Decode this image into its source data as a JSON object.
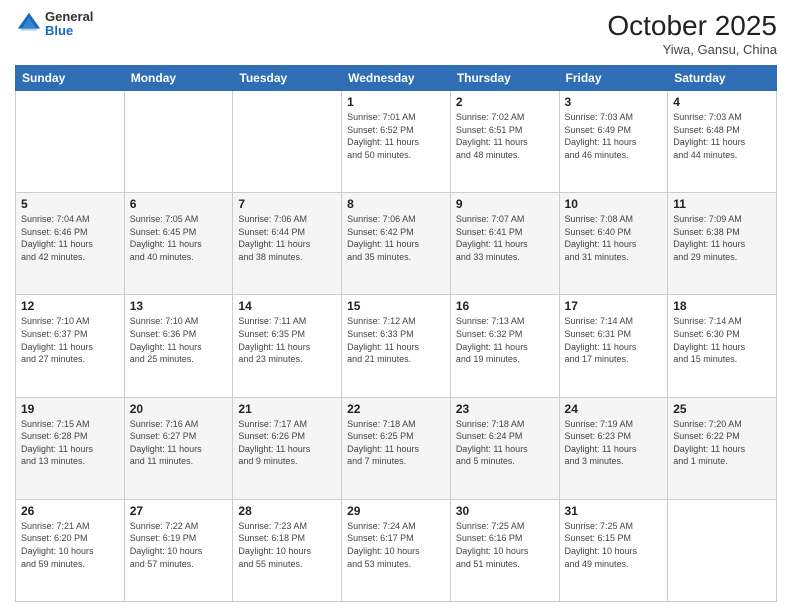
{
  "header": {
    "logo": {
      "general": "General",
      "blue": "Blue"
    },
    "title": "October 2025",
    "location": "Yiwa, Gansu, China"
  },
  "days_of_week": [
    "Sunday",
    "Monday",
    "Tuesday",
    "Wednesday",
    "Thursday",
    "Friday",
    "Saturday"
  ],
  "weeks": [
    {
      "days": [
        {
          "number": "",
          "info": ""
        },
        {
          "number": "",
          "info": ""
        },
        {
          "number": "",
          "info": ""
        },
        {
          "number": "1",
          "info": "Sunrise: 7:01 AM\nSunset: 6:52 PM\nDaylight: 11 hours\nand 50 minutes."
        },
        {
          "number": "2",
          "info": "Sunrise: 7:02 AM\nSunset: 6:51 PM\nDaylight: 11 hours\nand 48 minutes."
        },
        {
          "number": "3",
          "info": "Sunrise: 7:03 AM\nSunset: 6:49 PM\nDaylight: 11 hours\nand 46 minutes."
        },
        {
          "number": "4",
          "info": "Sunrise: 7:03 AM\nSunset: 6:48 PM\nDaylight: 11 hours\nand 44 minutes."
        }
      ]
    },
    {
      "days": [
        {
          "number": "5",
          "info": "Sunrise: 7:04 AM\nSunset: 6:46 PM\nDaylight: 11 hours\nand 42 minutes."
        },
        {
          "number": "6",
          "info": "Sunrise: 7:05 AM\nSunset: 6:45 PM\nDaylight: 11 hours\nand 40 minutes."
        },
        {
          "number": "7",
          "info": "Sunrise: 7:06 AM\nSunset: 6:44 PM\nDaylight: 11 hours\nand 38 minutes."
        },
        {
          "number": "8",
          "info": "Sunrise: 7:06 AM\nSunset: 6:42 PM\nDaylight: 11 hours\nand 35 minutes."
        },
        {
          "number": "9",
          "info": "Sunrise: 7:07 AM\nSunset: 6:41 PM\nDaylight: 11 hours\nand 33 minutes."
        },
        {
          "number": "10",
          "info": "Sunrise: 7:08 AM\nSunset: 6:40 PM\nDaylight: 11 hours\nand 31 minutes."
        },
        {
          "number": "11",
          "info": "Sunrise: 7:09 AM\nSunset: 6:38 PM\nDaylight: 11 hours\nand 29 minutes."
        }
      ]
    },
    {
      "days": [
        {
          "number": "12",
          "info": "Sunrise: 7:10 AM\nSunset: 6:37 PM\nDaylight: 11 hours\nand 27 minutes."
        },
        {
          "number": "13",
          "info": "Sunrise: 7:10 AM\nSunset: 6:36 PM\nDaylight: 11 hours\nand 25 minutes."
        },
        {
          "number": "14",
          "info": "Sunrise: 7:11 AM\nSunset: 6:35 PM\nDaylight: 11 hours\nand 23 minutes."
        },
        {
          "number": "15",
          "info": "Sunrise: 7:12 AM\nSunset: 6:33 PM\nDaylight: 11 hours\nand 21 minutes."
        },
        {
          "number": "16",
          "info": "Sunrise: 7:13 AM\nSunset: 6:32 PM\nDaylight: 11 hours\nand 19 minutes."
        },
        {
          "number": "17",
          "info": "Sunrise: 7:14 AM\nSunset: 6:31 PM\nDaylight: 11 hours\nand 17 minutes."
        },
        {
          "number": "18",
          "info": "Sunrise: 7:14 AM\nSunset: 6:30 PM\nDaylight: 11 hours\nand 15 minutes."
        }
      ]
    },
    {
      "days": [
        {
          "number": "19",
          "info": "Sunrise: 7:15 AM\nSunset: 6:28 PM\nDaylight: 11 hours\nand 13 minutes."
        },
        {
          "number": "20",
          "info": "Sunrise: 7:16 AM\nSunset: 6:27 PM\nDaylight: 11 hours\nand 11 minutes."
        },
        {
          "number": "21",
          "info": "Sunrise: 7:17 AM\nSunset: 6:26 PM\nDaylight: 11 hours\nand 9 minutes."
        },
        {
          "number": "22",
          "info": "Sunrise: 7:18 AM\nSunset: 6:25 PM\nDaylight: 11 hours\nand 7 minutes."
        },
        {
          "number": "23",
          "info": "Sunrise: 7:18 AM\nSunset: 6:24 PM\nDaylight: 11 hours\nand 5 minutes."
        },
        {
          "number": "24",
          "info": "Sunrise: 7:19 AM\nSunset: 6:23 PM\nDaylight: 11 hours\nand 3 minutes."
        },
        {
          "number": "25",
          "info": "Sunrise: 7:20 AM\nSunset: 6:22 PM\nDaylight: 11 hours\nand 1 minute."
        }
      ]
    },
    {
      "days": [
        {
          "number": "26",
          "info": "Sunrise: 7:21 AM\nSunset: 6:20 PM\nDaylight: 10 hours\nand 59 minutes."
        },
        {
          "number": "27",
          "info": "Sunrise: 7:22 AM\nSunset: 6:19 PM\nDaylight: 10 hours\nand 57 minutes."
        },
        {
          "number": "28",
          "info": "Sunrise: 7:23 AM\nSunset: 6:18 PM\nDaylight: 10 hours\nand 55 minutes."
        },
        {
          "number": "29",
          "info": "Sunrise: 7:24 AM\nSunset: 6:17 PM\nDaylight: 10 hours\nand 53 minutes."
        },
        {
          "number": "30",
          "info": "Sunrise: 7:25 AM\nSunset: 6:16 PM\nDaylight: 10 hours\nand 51 minutes."
        },
        {
          "number": "31",
          "info": "Sunrise: 7:25 AM\nSunset: 6:15 PM\nDaylight: 10 hours\nand 49 minutes."
        },
        {
          "number": "",
          "info": ""
        }
      ]
    }
  ]
}
